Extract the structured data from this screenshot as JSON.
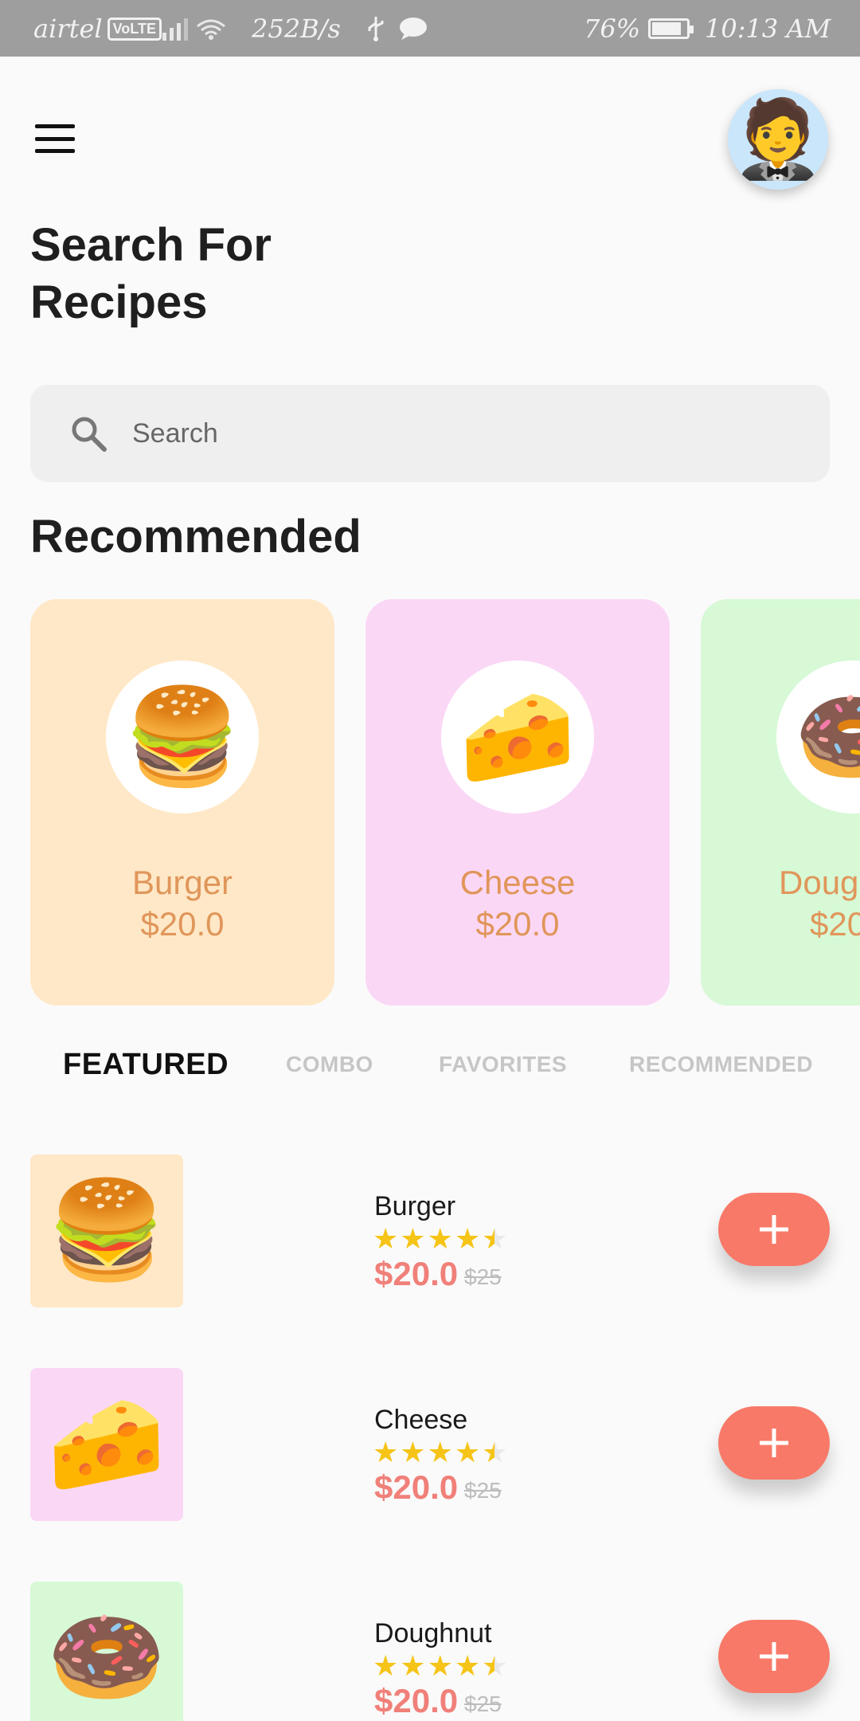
{
  "status_bar": {
    "carrier": "airtel",
    "volte": "VoLTE",
    "speed": "252B/s",
    "battery": "76%",
    "time": "10:13 AM"
  },
  "header": {
    "title": "Search For Recipes",
    "avatar_icon": "man-in-tuxedo-emoji"
  },
  "search": {
    "placeholder": "Search"
  },
  "recommended": {
    "title": "Recommended",
    "cards": [
      {
        "name": "Burger",
        "price": "$20.0",
        "emoji": "🍔",
        "bg": "#ffe8c7"
      },
      {
        "name": "Cheese",
        "price": "$20.0",
        "emoji": "🧀",
        "bg": "#fbd7f6"
      },
      {
        "name": "Doug",
        "price": "$20",
        "emoji": "🍩",
        "bg": "#d7f9d6"
      }
    ]
  },
  "tabs": [
    "FEATURED",
    "COMBO",
    "FAVORITES",
    "RECOMMENDED"
  ],
  "items": [
    {
      "name": "Burger",
      "price": "$20.0",
      "old_price": "$25",
      "rating": 4.5,
      "emoji": "🍔",
      "bg": "#ffe8c7"
    },
    {
      "name": "Cheese",
      "price": "$20.0",
      "old_price": "$25",
      "rating": 4.5,
      "emoji": "🧀",
      "bg": "#fbd7f6"
    },
    {
      "name": "Doughnut",
      "price": "$20.0",
      "old_price": "$25",
      "rating": 4.5,
      "emoji": "🍩",
      "bg": "#d7f9d6"
    }
  ],
  "colors": {
    "accent": "#f87968",
    "price": "#f08079",
    "card_text": "#e0965a",
    "star": "#f5c416"
  }
}
